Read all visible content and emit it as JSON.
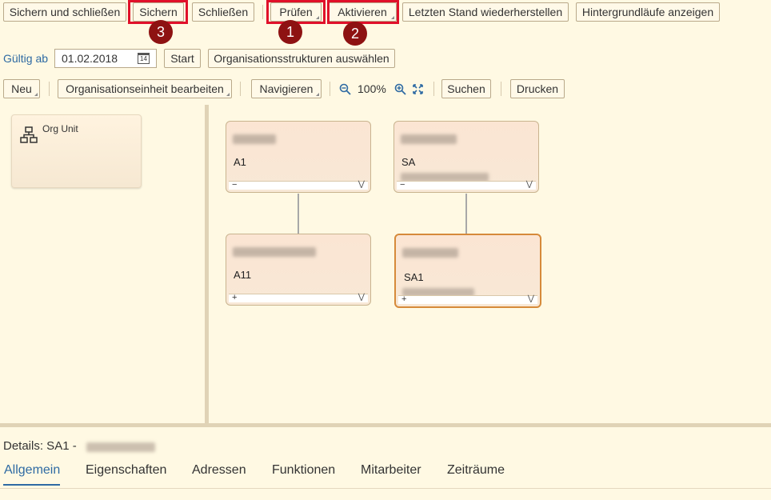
{
  "toolbar": {
    "save_close": "Sichern und schließen",
    "save": "Sichern",
    "close": "Schließen",
    "check": "Prüfen",
    "activate": "Aktivieren",
    "restore": "Letzten Stand wiederherstellen",
    "background": "Hintergrundläufe anzeigen"
  },
  "badges": {
    "b1": "1",
    "b2": "2",
    "b3": "3"
  },
  "filter": {
    "valid_from_label": "Gültig ab",
    "date": "01.02.2018",
    "calendar_icon": "14",
    "start": "Start",
    "select_structures": "Organisationsstrukturen auswählen"
  },
  "actions": {
    "new": "Neu",
    "edit_unit": "Organisationseinheit bearbeiten",
    "navigate": "Navigieren",
    "zoom": "100%",
    "search": "Suchen",
    "print": "Drucken"
  },
  "palette": {
    "org_unit": "Org Unit"
  },
  "nodes": [
    {
      "code": "A1",
      "expander": "−"
    },
    {
      "code": "SA",
      "expander": "−"
    },
    {
      "code": "A11",
      "expander": "+"
    },
    {
      "code": "SA1",
      "expander": "+"
    }
  ],
  "details": {
    "title": "Details: SA1 -"
  },
  "tabs": [
    "Allgemein",
    "Eigenschaften",
    "Adressen",
    "Funktionen",
    "Mitarbeiter",
    "Zeiträume"
  ],
  "colors": {
    "accent": "#2e6aa3",
    "highlight": "#e0102a",
    "badge": "#8e1212",
    "selected_border": "#d68a3a"
  },
  "icons": {
    "calendar": "calendar-icon",
    "zoom_out": "zoom-out-icon",
    "zoom_in": "zoom-in-icon",
    "fit": "fit-to-screen-icon",
    "org": "org-structure-icon",
    "chevron": "chevron-double-down-icon"
  }
}
